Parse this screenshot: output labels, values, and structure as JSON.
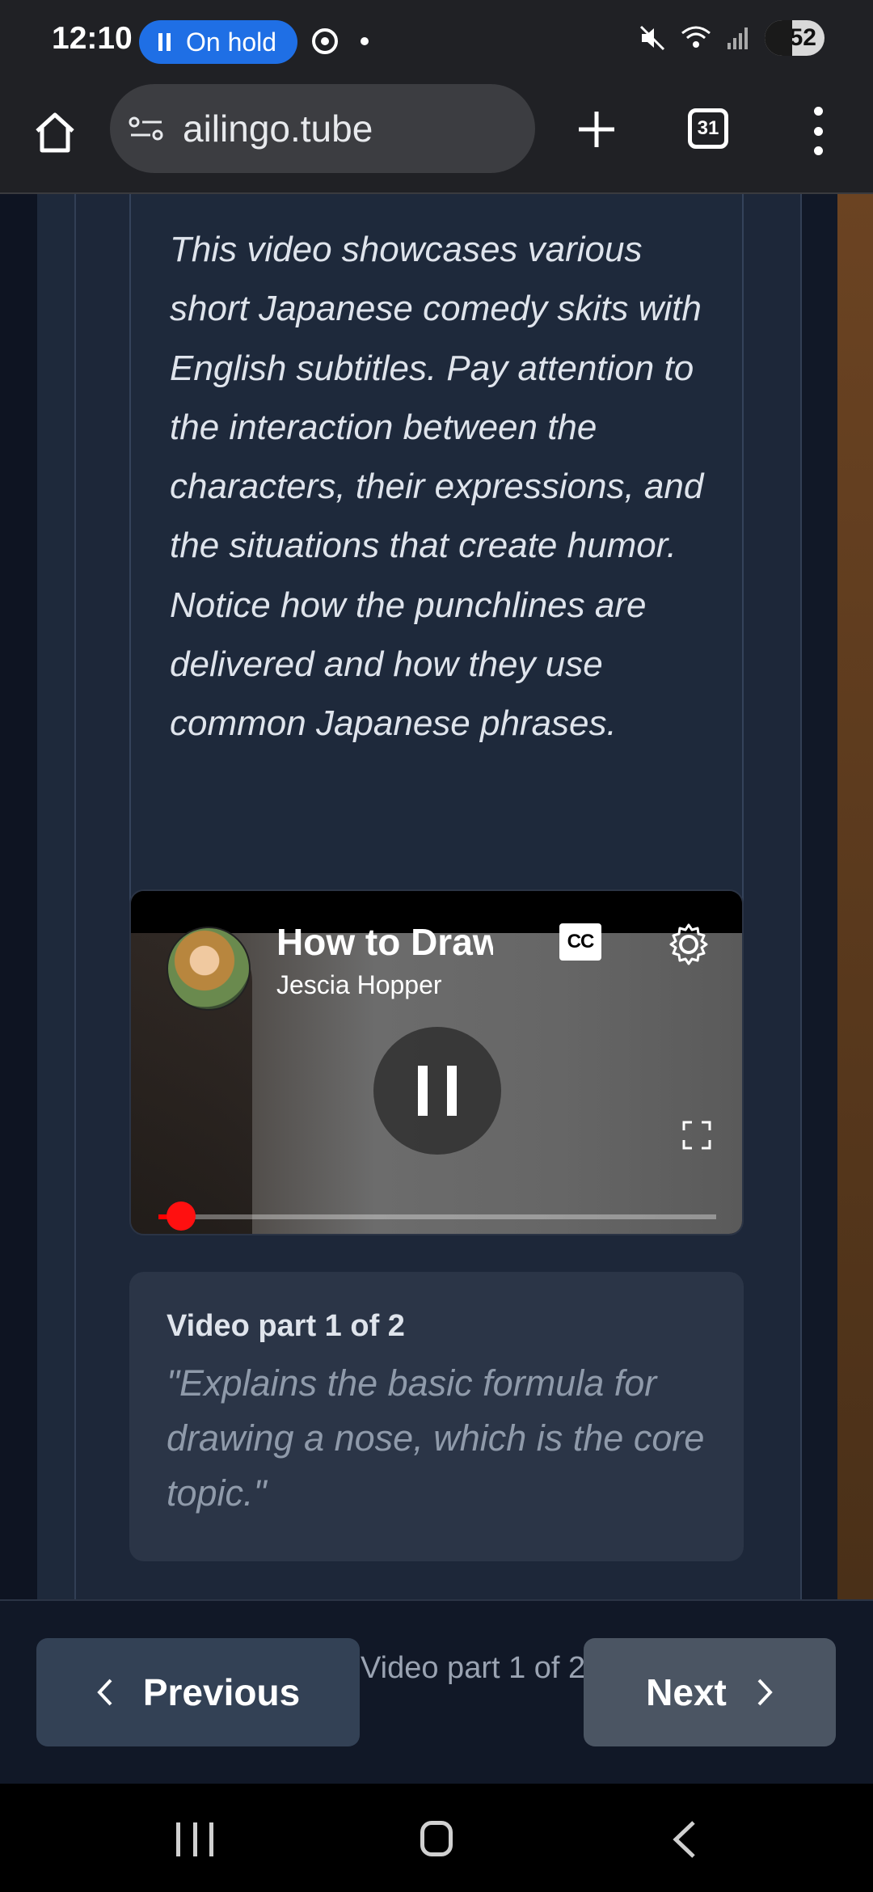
{
  "status_bar": {
    "time": "12:10",
    "call_status": "On hold",
    "battery": "52",
    "icons": [
      "pause-icon",
      "chrome-icon",
      "dot-icon",
      "mute-icon",
      "wifi-icon",
      "signal-icon",
      "battery-icon"
    ]
  },
  "browser": {
    "url": "ailingo.tube",
    "tab_count": "31",
    "icons": [
      "home-icon",
      "site-settings-icon",
      "new-tab-icon",
      "tabs-icon",
      "menu-icon"
    ]
  },
  "description": {
    "text": "This video showcases various short Japanese comedy skits with English subtitles. Pay attention to the interaction between the characters, their expressions, and the situations that create humor. Notice how the punchlines are delivered and how they use common Japanese phrases."
  },
  "video": {
    "title": "How to Draw",
    "author": "Jescia Hopper",
    "cc_label": "CC",
    "progress_fraction": 0.04,
    "state": "playing"
  },
  "part_info": {
    "label": "Video part 1 of 2",
    "description": "\"Explains the basic formula for drawing a nose, which is the core topic.\""
  },
  "nav": {
    "previous_label": "Previous",
    "next_label": "Next",
    "status": "Video part 1 of 2"
  },
  "colors": {
    "accent_blue": "#1f6fe5",
    "progress_red": "#ff0000",
    "prev_button": "#334155",
    "next_button": "#4b5563"
  }
}
